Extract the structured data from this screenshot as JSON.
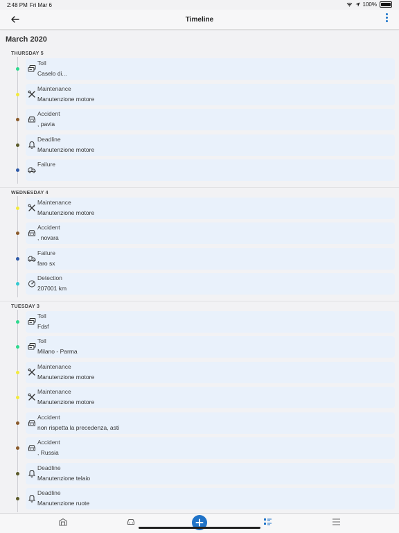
{
  "status_bar": {
    "time": "2:48 PM",
    "date": "Fri Mar 6",
    "battery": "100%"
  },
  "navbar": {
    "title": "Timeline"
  },
  "month": "March 2020",
  "colors": {
    "Toll": "#2ed98e",
    "Maintenance": "#f2ea3e",
    "Accident": "#8a5a2a",
    "Deadline": "#5b5b2a",
    "Failure": "#2f5aa8",
    "Detection": "#33c9d1"
  },
  "days": [
    {
      "label": "THURSDAY 5",
      "events": [
        {
          "type": "Toll",
          "icon": "toll-icon",
          "title": "Toll",
          "detail": "Caselo di..."
        },
        {
          "type": "Maintenance",
          "icon": "wrench-icon",
          "title": "Maintenance",
          "detail": "Manutenzione motore"
        },
        {
          "type": "Accident",
          "icon": "car-accident-icon",
          "title": "Accident",
          "detail": ", pavia"
        },
        {
          "type": "Deadline",
          "icon": "bell-icon",
          "title": "Deadline",
          "detail": "Manutenzione motore"
        },
        {
          "type": "Failure",
          "icon": "tow-truck-icon",
          "title": "Failure",
          "detail": ""
        }
      ]
    },
    {
      "label": "WEDNESDAY 4",
      "events": [
        {
          "type": "Maintenance",
          "icon": "wrench-icon",
          "title": "Maintenance",
          "detail": "Manutenzione motore"
        },
        {
          "type": "Accident",
          "icon": "car-accident-icon",
          "title": "Accident",
          "detail": ", novara"
        },
        {
          "type": "Failure",
          "icon": "tow-truck-icon",
          "title": "Failure",
          "detail": "faro sx"
        },
        {
          "type": "Detection",
          "icon": "gauge-icon",
          "title": "Detection",
          "detail": "207001 km"
        }
      ]
    },
    {
      "label": "TUESDAY 3",
      "events": [
        {
          "type": "Toll",
          "icon": "toll-icon",
          "title": "Toll",
          "detail": "Fdsf"
        },
        {
          "type": "Toll",
          "icon": "toll-icon",
          "title": "Toll",
          "detail": "Milano - Parma"
        },
        {
          "type": "Maintenance",
          "icon": "wrench-icon",
          "title": "Maintenance",
          "detail": "Manutenzione motore"
        },
        {
          "type": "Maintenance",
          "icon": "wrench-icon",
          "title": "Maintenance",
          "detail": "Manutenzione motore"
        },
        {
          "type": "Accident",
          "icon": "car-accident-icon",
          "title": "Accident",
          "detail": "non rispetta la precedenza, asti"
        },
        {
          "type": "Accident",
          "icon": "car-accident-icon",
          "title": "Accident",
          "detail": ", Russia"
        },
        {
          "type": "Deadline",
          "icon": "bell-icon",
          "title": "Deadline",
          "detail": "Manutenzione telaio"
        },
        {
          "type": "Deadline",
          "icon": "bell-icon",
          "title": "Deadline",
          "detail": "Manutenzione ruote"
        }
      ]
    }
  ],
  "tab_bar": {
    "items": [
      {
        "name": "home-tab",
        "icon": "garage-icon"
      },
      {
        "name": "vehicles-tab",
        "icon": "car-icon"
      },
      {
        "name": "add-button",
        "icon": "plus-icon"
      },
      {
        "name": "timeline-tab",
        "icon": "list-icon",
        "active": true
      },
      {
        "name": "menu-tab",
        "icon": "hamburger-icon"
      }
    ]
  }
}
